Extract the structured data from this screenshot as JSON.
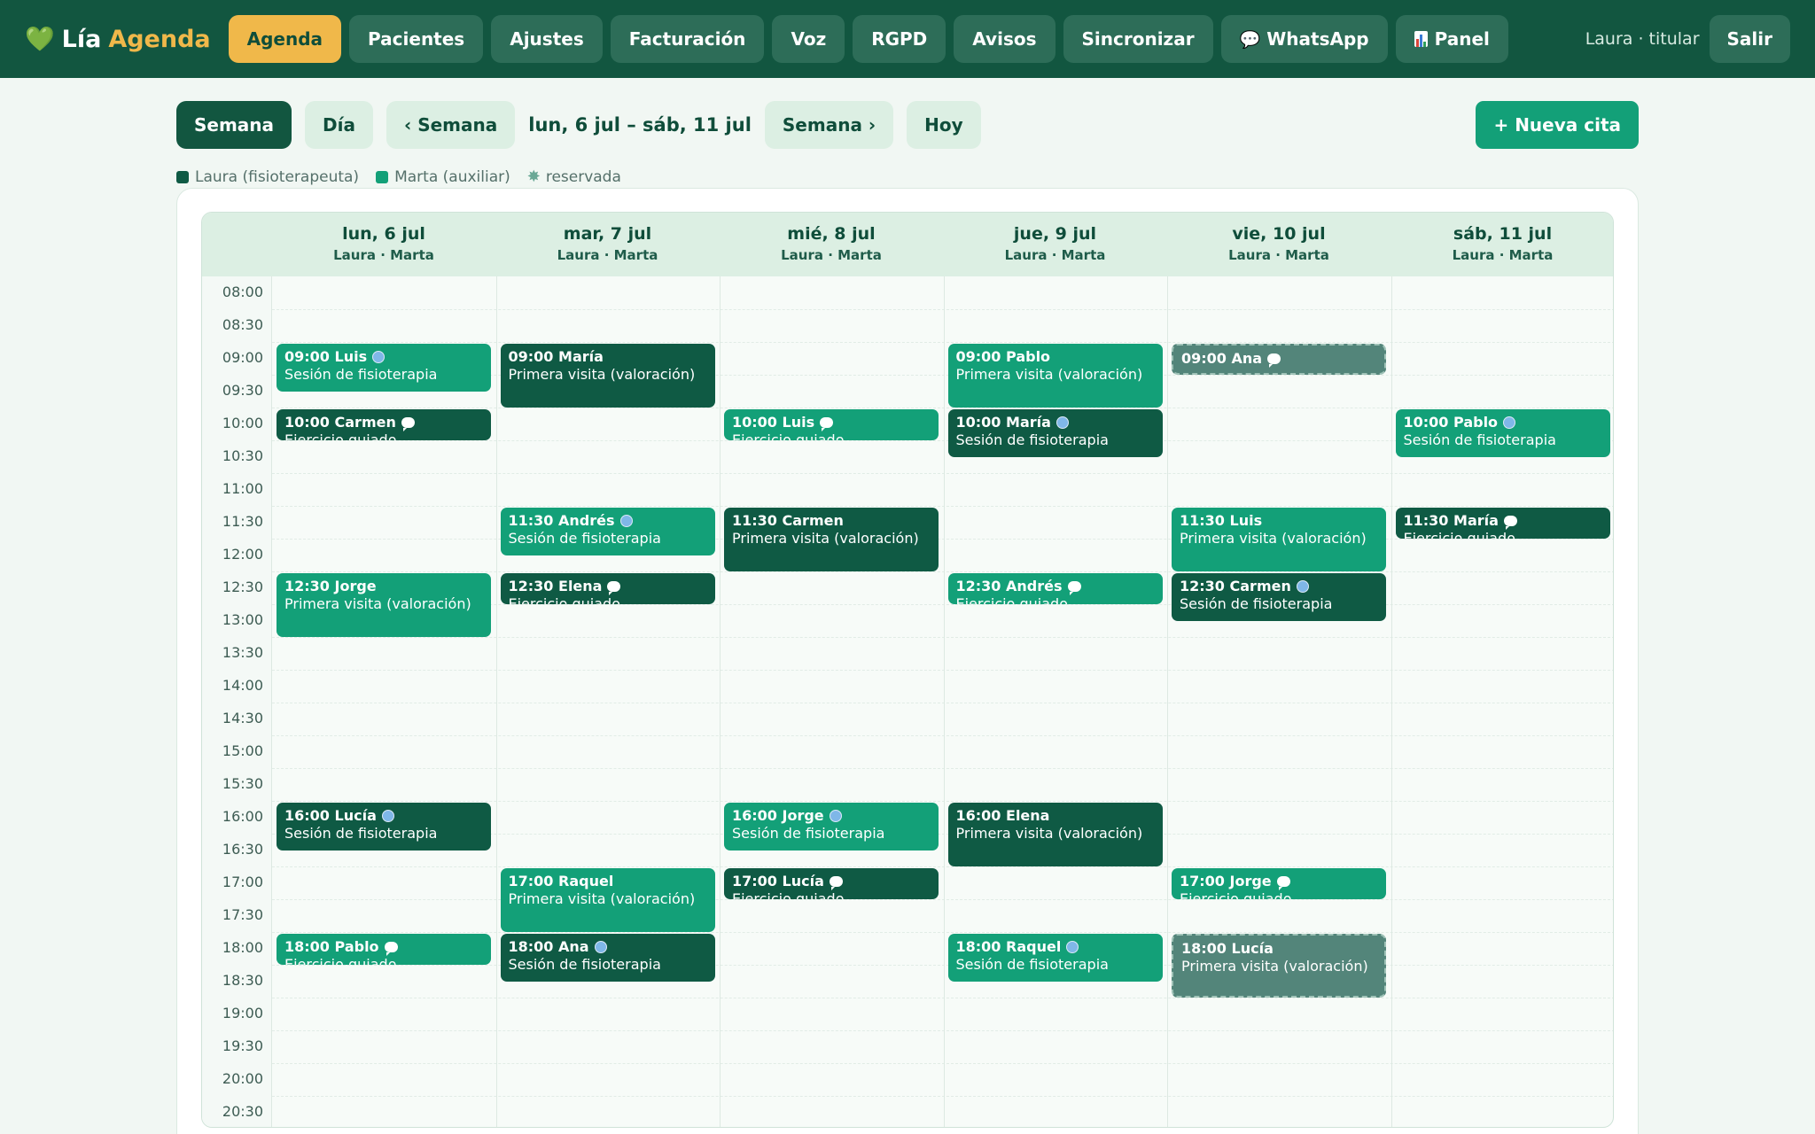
{
  "app": {
    "brand_icon": "💚",
    "brand_part1": "Lía",
    "brand_part2": "Agenda"
  },
  "nav": [
    {
      "label": "Agenda",
      "active": true
    },
    {
      "label": "Pacientes"
    },
    {
      "label": "Ajustes"
    },
    {
      "label": "Facturación"
    },
    {
      "label": "Voz"
    },
    {
      "label": "RGPD"
    },
    {
      "label": "Avisos"
    },
    {
      "label": "Sincronizar"
    },
    {
      "label": "WhatsApp",
      "icon": "chat-icon"
    },
    {
      "label": "Panel",
      "icon": "bar-chart-icon"
    }
  ],
  "user": {
    "label": "Laura · titular",
    "logout": "Salir"
  },
  "toolbar": {
    "view_week": "Semana",
    "view_day": "Día",
    "prev": "‹ Semana",
    "range": "lun, 6 jul – sáb, 11 jul",
    "next": "Semana ›",
    "today": "Hoy",
    "new_appointment": "+ Nueva cita"
  },
  "legend": {
    "laura": "Laura (fisioterapeuta)",
    "marta": "Marta (auxiliar)",
    "reserved": "reservada"
  },
  "colors": {
    "laura": "#0f5a44",
    "marta": "#13a078",
    "reserved": "#53857a",
    "accent": "#f0b84a",
    "topbar": "#125640"
  },
  "days": [
    {
      "name": "lun, 6 jul",
      "staff": "Laura · Marta"
    },
    {
      "name": "mar, 7 jul",
      "staff": "Laura · Marta"
    },
    {
      "name": "mié, 8 jul",
      "staff": "Laura · Marta"
    },
    {
      "name": "jue, 9 jul",
      "staff": "Laura · Marta"
    },
    {
      "name": "vie, 10 jul",
      "staff": "Laura · Marta"
    },
    {
      "name": "sáb, 11 jul",
      "staff": "Laura · Marta"
    }
  ],
  "time_slots": [
    "08:00",
    "08:30",
    "09:00",
    "09:30",
    "10:00",
    "10:30",
    "11:00",
    "11:30",
    "12:00",
    "12:30",
    "13:00",
    "13:30",
    "14:00",
    "14:30",
    "15:00",
    "15:30",
    "16:00",
    "16:30",
    "17:00",
    "17:30",
    "18:00",
    "18:30",
    "19:00",
    "19:30",
    "20:00",
    "20:30"
  ],
  "appointments": [
    {
      "day": 0,
      "time": "09:00",
      "patient": "Luis",
      "type": "Sesión de fisioterapia",
      "staff": "marta",
      "channel": "web",
      "duration": 45
    },
    {
      "day": 0,
      "time": "10:00",
      "patient": "Carmen",
      "type": "Ejercicio guiado",
      "staff": "laura",
      "channel": "whatsapp",
      "duration": 30
    },
    {
      "day": 0,
      "time": "12:30",
      "patient": "Jorge",
      "type": "Primera visita (valoración)",
      "staff": "marta",
      "channel": "",
      "duration": 60
    },
    {
      "day": 0,
      "time": "16:00",
      "patient": "Lucía",
      "type": "Sesión de fisioterapia",
      "staff": "laura",
      "channel": "web",
      "duration": 45
    },
    {
      "day": 0,
      "time": "18:00",
      "patient": "Pablo",
      "type": "Ejercicio guiado",
      "staff": "marta",
      "channel": "whatsapp",
      "duration": 30
    },
    {
      "day": 1,
      "time": "09:00",
      "patient": "María",
      "type": "Primera visita (valoración)",
      "staff": "laura",
      "channel": "",
      "duration": 60
    },
    {
      "day": 1,
      "time": "11:30",
      "patient": "Andrés",
      "type": "Sesión de fisioterapia",
      "staff": "marta",
      "channel": "web",
      "duration": 45
    },
    {
      "day": 1,
      "time": "12:30",
      "patient": "Elena",
      "type": "Ejercicio guiado",
      "staff": "laura",
      "channel": "whatsapp",
      "duration": 30
    },
    {
      "day": 1,
      "time": "17:00",
      "patient": "Raquel",
      "type": "Primera visita (valoración)",
      "staff": "marta",
      "channel": "",
      "duration": 60
    },
    {
      "day": 1,
      "time": "18:00",
      "patient": "Ana",
      "type": "Sesión de fisioterapia",
      "staff": "laura",
      "channel": "web",
      "duration": 45
    },
    {
      "day": 2,
      "time": "10:00",
      "patient": "Luis",
      "type": "Ejercicio guiado",
      "staff": "marta",
      "channel": "whatsapp",
      "duration": 30
    },
    {
      "day": 2,
      "time": "11:30",
      "patient": "Carmen",
      "type": "Primera visita (valoración)",
      "staff": "laura",
      "channel": "",
      "duration": 60
    },
    {
      "day": 2,
      "time": "16:00",
      "patient": "Jorge",
      "type": "Sesión de fisioterapia",
      "staff": "marta",
      "channel": "web",
      "duration": 45
    },
    {
      "day": 2,
      "time": "17:00",
      "patient": "Lucía",
      "type": "Ejercicio guiado",
      "staff": "laura",
      "channel": "whatsapp",
      "duration": 30
    },
    {
      "day": 3,
      "time": "09:00",
      "patient": "Pablo",
      "type": "Primera visita (valoración)",
      "staff": "marta",
      "channel": "",
      "duration": 60
    },
    {
      "day": 3,
      "time": "10:00",
      "patient": "María",
      "type": "Sesión de fisioterapia",
      "staff": "laura",
      "channel": "web",
      "duration": 45
    },
    {
      "day": 3,
      "time": "12:30",
      "patient": "Andrés",
      "type": "Ejercicio guiado",
      "staff": "marta",
      "channel": "whatsapp",
      "duration": 30
    },
    {
      "day": 3,
      "time": "16:00",
      "patient": "Elena",
      "type": "Primera visita (valoración)",
      "staff": "laura",
      "channel": "",
      "duration": 60
    },
    {
      "day": 3,
      "time": "18:00",
      "patient": "Raquel",
      "type": "Sesión de fisioterapia",
      "staff": "marta",
      "channel": "web",
      "duration": 45
    },
    {
      "day": 4,
      "time": "09:00",
      "patient": "Ana",
      "type": "",
      "staff": "reserved",
      "channel": "whatsapp",
      "duration": 30
    },
    {
      "day": 4,
      "time": "11:30",
      "patient": "Luis",
      "type": "Primera visita (valoración)",
      "staff": "marta",
      "channel": "",
      "duration": 60
    },
    {
      "day": 4,
      "time": "12:30",
      "patient": "Carmen",
      "type": "Sesión de fisioterapia",
      "staff": "laura",
      "channel": "web",
      "duration": 45
    },
    {
      "day": 4,
      "time": "17:00",
      "patient": "Jorge",
      "type": "Ejercicio guiado",
      "staff": "marta",
      "channel": "whatsapp",
      "duration": 30
    },
    {
      "day": 4,
      "time": "18:00",
      "patient": "Lucía",
      "type": "Primera visita (valoración)",
      "staff": "reserved",
      "channel": "",
      "duration": 60
    },
    {
      "day": 5,
      "time": "10:00",
      "patient": "Pablo",
      "type": "Sesión de fisioterapia",
      "staff": "marta",
      "channel": "web",
      "duration": 45
    },
    {
      "day": 5,
      "time": "11:30",
      "patient": "María",
      "type": "Ejercicio guiado",
      "staff": "laura",
      "channel": "whatsapp",
      "duration": 30
    }
  ]
}
